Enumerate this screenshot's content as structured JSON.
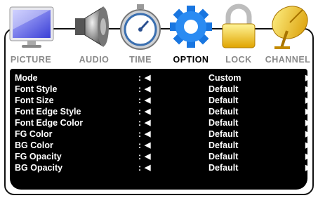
{
  "tabs": [
    {
      "label": "PICTURE",
      "icon": "monitor-icon",
      "active": false
    },
    {
      "label": "AUDIO",
      "icon": "speaker-icon",
      "active": false
    },
    {
      "label": "TIME",
      "icon": "stopwatch-icon",
      "active": false
    },
    {
      "label": "OPTION",
      "icon": "gear-icon",
      "active": true
    },
    {
      "label": "LOCK",
      "icon": "padlock-icon",
      "active": false
    },
    {
      "label": "CHANNEL",
      "icon": "satellite-dish-icon",
      "active": false
    }
  ],
  "menu": {
    "colon": ":",
    "left_arrow": "◀",
    "right_arrow": "▶",
    "rows": [
      {
        "label": "Mode",
        "value": "Custom"
      },
      {
        "label": "Font Style",
        "value": "Default"
      },
      {
        "label": "Font Size",
        "value": "Default"
      },
      {
        "label": "Font Edge Style",
        "value": "Default"
      },
      {
        "label": "Font Edge Color",
        "value": "Default"
      },
      {
        "label": "FG  Color",
        "value": "Default"
      },
      {
        "label": "BG  Color",
        "value": "Default"
      },
      {
        "label": "FG Opacity",
        "value": "Default"
      },
      {
        "label": "BG Opacity",
        "value": "Default"
      }
    ]
  },
  "colors": {
    "panel": "#000000",
    "active_tab_text": "#000000",
    "inactive_tab_text": "#8a8a8a"
  }
}
